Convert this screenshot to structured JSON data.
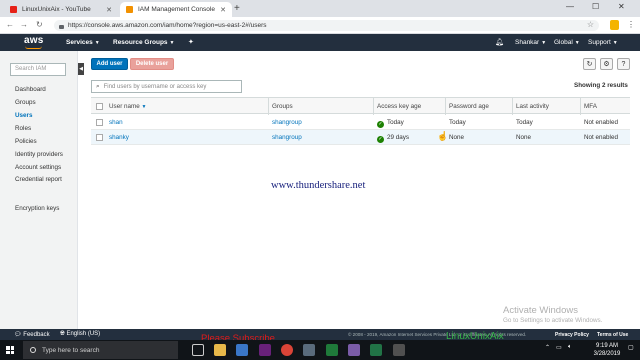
{
  "browser": {
    "tabs": [
      {
        "title": "LinuxUnixAix - YouTube",
        "icon": "youtube-icon"
      },
      {
        "title": "IAM Management Console",
        "icon": "aws-icon"
      }
    ],
    "new_tab": "+",
    "url": "https://console.aws.amazon.com/iam/home?region=us-east-2#/users",
    "window_controls": {
      "minimize": "—",
      "maximize": "☐",
      "close": "✕"
    }
  },
  "aws_header": {
    "logo": "aws",
    "services": "Services",
    "resource_groups": "Resource Groups",
    "user": "Shankar",
    "region": "Global",
    "support": "Support"
  },
  "sidebar": {
    "search_placeholder": "Search IAM",
    "items": [
      {
        "label": "Dashboard",
        "active": false
      },
      {
        "label": "Groups",
        "active": false
      },
      {
        "label": "Users",
        "active": true
      },
      {
        "label": "Roles",
        "active": false
      },
      {
        "label": "Policies",
        "active": false
      },
      {
        "label": "Identity providers",
        "active": false
      },
      {
        "label": "Account settings",
        "active": false
      },
      {
        "label": "Credential report",
        "active": false
      },
      {
        "label": "Encryption keys",
        "active": false
      }
    ]
  },
  "toolbar": {
    "add_user": "Add user",
    "delete_user": "Delete user",
    "refresh_icon": "refresh-icon",
    "settings_icon": "gear-icon",
    "help_icon": "help-icon"
  },
  "table": {
    "search_placeholder": "Find users by username or access key",
    "showing": "Showing 2 results",
    "columns": [
      "User name",
      "Groups",
      "Access key age",
      "Password age",
      "Last activity",
      "MFA"
    ],
    "rows": [
      {
        "user": "shan",
        "groups": "shangroup",
        "key_age": "Today",
        "password_age": "Today",
        "last_activity": "Today",
        "mfa": "Not enabled"
      },
      {
        "user": "shanky",
        "groups": "shangroup",
        "key_age": "29 days",
        "password_age": "None",
        "last_activity": "None",
        "mfa": "Not enabled"
      }
    ]
  },
  "watermark": "www.thundershare.net",
  "activate": {
    "title": "Activate Windows",
    "subtitle": "Go to Settings to activate Windows."
  },
  "aws_footer": {
    "feedback": "Feedback",
    "language": "English (US)",
    "copyright": "© 2008 - 2019, Amazon Internet Services Private Ltd. or its affiliates. All rights reserved.",
    "privacy": "Privacy Policy",
    "terms": "Terms of Use"
  },
  "taskbar": {
    "search_placeholder": "Type here to search",
    "time": "9:19 AM",
    "date": "3/28/2019"
  },
  "overlays": {
    "subscribe": "Please Subscribe",
    "channel": "LinuxUnixAix"
  },
  "colors": {
    "aws_nav": "#232f3e",
    "aws_orange": "#ff9900",
    "link": "#0073bb",
    "primary": "#0073bb",
    "ok": "#1d8102"
  }
}
